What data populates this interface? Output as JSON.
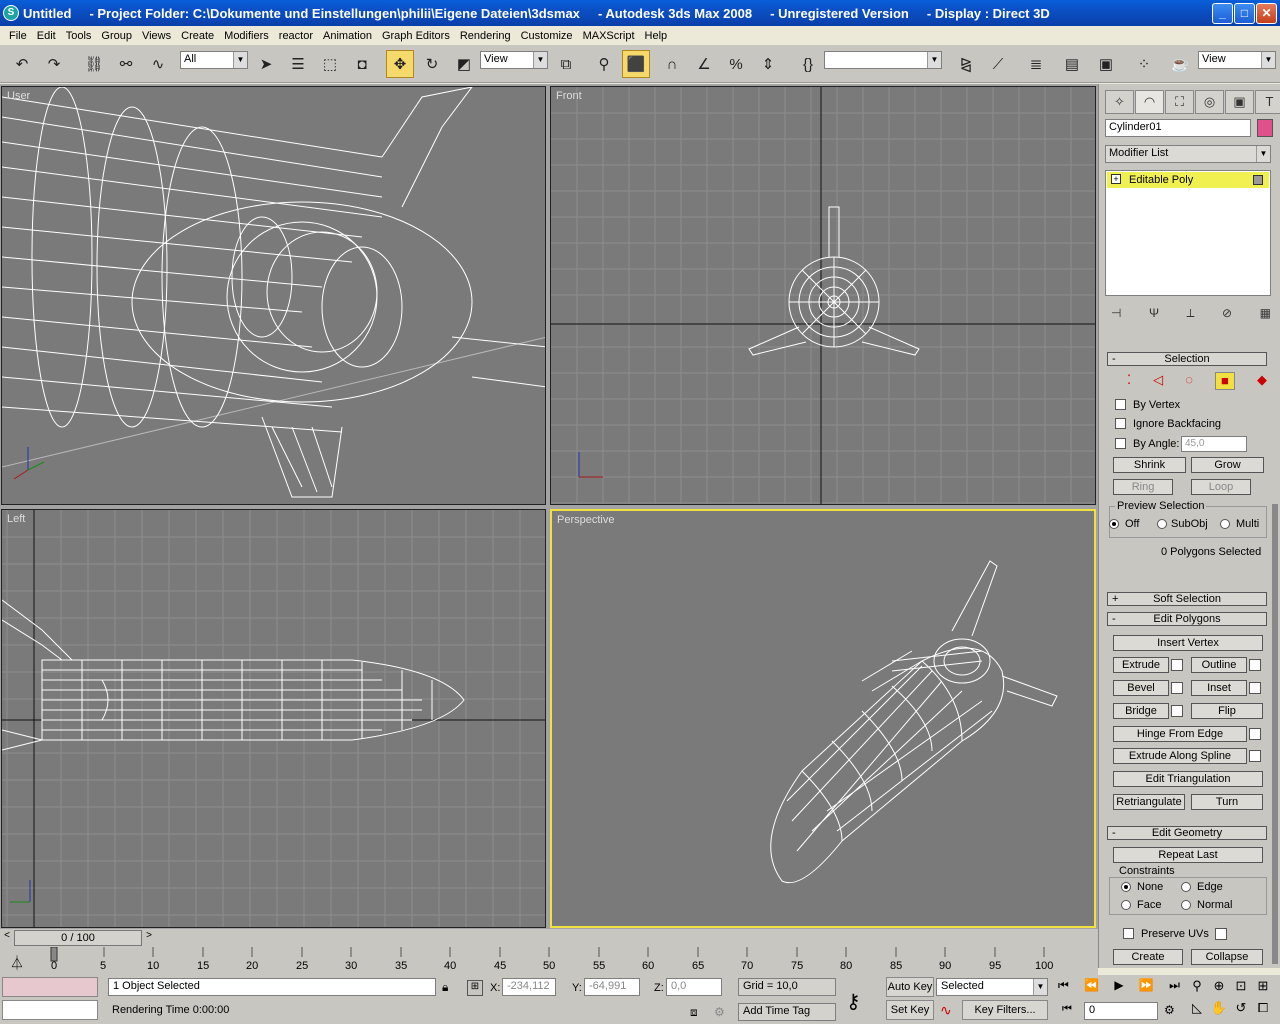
{
  "titlebar": {
    "title": "Untitled     - Project Folder: C:\\Dokumente und Einstellungen\\philii\\Eigene Dateien\\3dsmax     - Autodesk 3ds Max 2008     - Unregistered Version     - Display : Direct 3D",
    "app_icon": "3dsmax-icon"
  },
  "menu": [
    "File",
    "Edit",
    "Tools",
    "Group",
    "Views",
    "Create",
    "Modifiers",
    "reactor",
    "Animation",
    "Graph Editors",
    "Rendering",
    "Customize",
    "MAXScript",
    "Help"
  ],
  "toolbar": {
    "selection_filter": "All",
    "ref_coord": "View",
    "view_dropdown": "View",
    "named_selection": ""
  },
  "viewports": {
    "top_left": "User",
    "top_right": "Front",
    "bottom_left": "Left",
    "bottom_right": "Perspective"
  },
  "command_panel": {
    "object_name": "Cylinder01",
    "modifier_list": "Modifier List",
    "stack_item": "Editable Poly",
    "selection": {
      "header": "Selection",
      "by_vertex": "By Vertex",
      "ignore_backfacing": "Ignore Backfacing",
      "by_angle": "By Angle:",
      "angle_value": "45,0",
      "shrink": "Shrink",
      "grow": "Grow",
      "ring": "Ring",
      "loop": "Loop",
      "preview_label": "Preview Selection",
      "off": "Off",
      "subobj": "SubObj",
      "multi": "Multi",
      "status": "0 Polygons Selected"
    },
    "soft_selection": "Soft Selection",
    "edit_polygons": {
      "header": "Edit Polygons",
      "insert_vertex": "Insert Vertex",
      "extrude": "Extrude",
      "outline": "Outline",
      "bevel": "Bevel",
      "inset": "Inset",
      "bridge": "Bridge",
      "flip": "Flip",
      "hinge": "Hinge From Edge",
      "extrude_spline": "Extrude Along Spline",
      "edit_tri": "Edit Triangulation",
      "retriangulate": "Retriangulate",
      "turn": "Turn"
    },
    "edit_geometry": {
      "header": "Edit Geometry",
      "repeat_last": "Repeat Last",
      "constraints": "Constraints",
      "none": "None",
      "edge": "Edge",
      "face": "Face",
      "normal": "Normal",
      "preserve_uvs": "Preserve UVs",
      "create": "Create",
      "collapse": "Collapse"
    }
  },
  "timeline": {
    "frame": "0 / 100",
    "ticks": [
      "0",
      "5",
      "10",
      "15",
      "20",
      "25",
      "30",
      "35",
      "40",
      "45",
      "50",
      "55",
      "60",
      "65",
      "70",
      "75",
      "80",
      "85",
      "90",
      "95",
      "100"
    ]
  },
  "status": {
    "selected": "1 Object Selected",
    "render_time": "Rendering Time  0:00:00",
    "x_label": "X:",
    "x": "-234,112",
    "y_label": "Y:",
    "y": "-64,991",
    "z_label": "Z:",
    "z": "0,0",
    "grid": "Grid = 10,0",
    "add_time_tag": "Add Time Tag",
    "auto_key": "Auto Key",
    "set_key": "Set Key",
    "key_mode": "Selected",
    "key_filters": "Key Filters...",
    "current_frame": "0"
  },
  "colors": {
    "viewport_bg": "#7a7a7a",
    "active_border": "#f0e040",
    "object_color": "#e0508a"
  }
}
